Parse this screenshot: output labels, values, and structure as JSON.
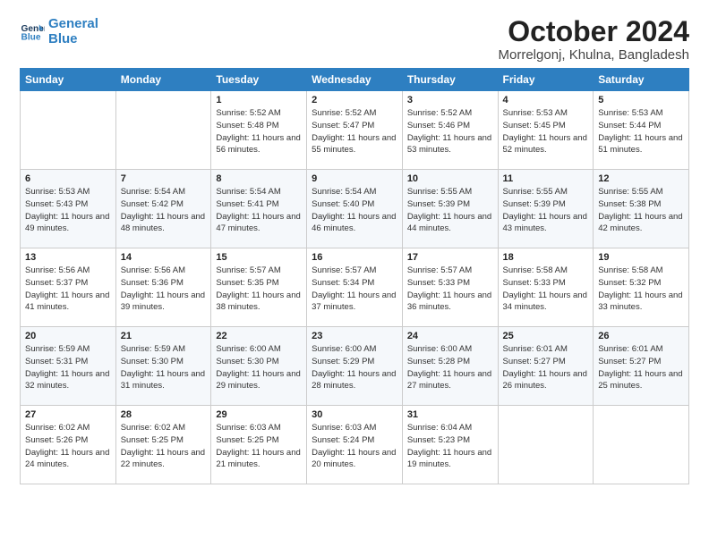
{
  "logo": {
    "line1": "General",
    "line2": "Blue"
  },
  "title": "October 2024",
  "location": "Morrelgonj, Khulna, Bangladesh",
  "weekdays": [
    "Sunday",
    "Monday",
    "Tuesday",
    "Wednesday",
    "Thursday",
    "Friday",
    "Saturday"
  ],
  "weeks": [
    [
      {
        "day": "",
        "detail": ""
      },
      {
        "day": "",
        "detail": ""
      },
      {
        "day": "1",
        "detail": "Sunrise: 5:52 AM\nSunset: 5:48 PM\nDaylight: 11 hours and 56 minutes."
      },
      {
        "day": "2",
        "detail": "Sunrise: 5:52 AM\nSunset: 5:47 PM\nDaylight: 11 hours and 55 minutes."
      },
      {
        "day": "3",
        "detail": "Sunrise: 5:52 AM\nSunset: 5:46 PM\nDaylight: 11 hours and 53 minutes."
      },
      {
        "day": "4",
        "detail": "Sunrise: 5:53 AM\nSunset: 5:45 PM\nDaylight: 11 hours and 52 minutes."
      },
      {
        "day": "5",
        "detail": "Sunrise: 5:53 AM\nSunset: 5:44 PM\nDaylight: 11 hours and 51 minutes."
      }
    ],
    [
      {
        "day": "6",
        "detail": "Sunrise: 5:53 AM\nSunset: 5:43 PM\nDaylight: 11 hours and 49 minutes."
      },
      {
        "day": "7",
        "detail": "Sunrise: 5:54 AM\nSunset: 5:42 PM\nDaylight: 11 hours and 48 minutes."
      },
      {
        "day": "8",
        "detail": "Sunrise: 5:54 AM\nSunset: 5:41 PM\nDaylight: 11 hours and 47 minutes."
      },
      {
        "day": "9",
        "detail": "Sunrise: 5:54 AM\nSunset: 5:40 PM\nDaylight: 11 hours and 46 minutes."
      },
      {
        "day": "10",
        "detail": "Sunrise: 5:55 AM\nSunset: 5:39 PM\nDaylight: 11 hours and 44 minutes."
      },
      {
        "day": "11",
        "detail": "Sunrise: 5:55 AM\nSunset: 5:39 PM\nDaylight: 11 hours and 43 minutes."
      },
      {
        "day": "12",
        "detail": "Sunrise: 5:55 AM\nSunset: 5:38 PM\nDaylight: 11 hours and 42 minutes."
      }
    ],
    [
      {
        "day": "13",
        "detail": "Sunrise: 5:56 AM\nSunset: 5:37 PM\nDaylight: 11 hours and 41 minutes."
      },
      {
        "day": "14",
        "detail": "Sunrise: 5:56 AM\nSunset: 5:36 PM\nDaylight: 11 hours and 39 minutes."
      },
      {
        "day": "15",
        "detail": "Sunrise: 5:57 AM\nSunset: 5:35 PM\nDaylight: 11 hours and 38 minutes."
      },
      {
        "day": "16",
        "detail": "Sunrise: 5:57 AM\nSunset: 5:34 PM\nDaylight: 11 hours and 37 minutes."
      },
      {
        "day": "17",
        "detail": "Sunrise: 5:57 AM\nSunset: 5:33 PM\nDaylight: 11 hours and 36 minutes."
      },
      {
        "day": "18",
        "detail": "Sunrise: 5:58 AM\nSunset: 5:33 PM\nDaylight: 11 hours and 34 minutes."
      },
      {
        "day": "19",
        "detail": "Sunrise: 5:58 AM\nSunset: 5:32 PM\nDaylight: 11 hours and 33 minutes."
      }
    ],
    [
      {
        "day": "20",
        "detail": "Sunrise: 5:59 AM\nSunset: 5:31 PM\nDaylight: 11 hours and 32 minutes."
      },
      {
        "day": "21",
        "detail": "Sunrise: 5:59 AM\nSunset: 5:30 PM\nDaylight: 11 hours and 31 minutes."
      },
      {
        "day": "22",
        "detail": "Sunrise: 6:00 AM\nSunset: 5:30 PM\nDaylight: 11 hours and 29 minutes."
      },
      {
        "day": "23",
        "detail": "Sunrise: 6:00 AM\nSunset: 5:29 PM\nDaylight: 11 hours and 28 minutes."
      },
      {
        "day": "24",
        "detail": "Sunrise: 6:00 AM\nSunset: 5:28 PM\nDaylight: 11 hours and 27 minutes."
      },
      {
        "day": "25",
        "detail": "Sunrise: 6:01 AM\nSunset: 5:27 PM\nDaylight: 11 hours and 26 minutes."
      },
      {
        "day": "26",
        "detail": "Sunrise: 6:01 AM\nSunset: 5:27 PM\nDaylight: 11 hours and 25 minutes."
      }
    ],
    [
      {
        "day": "27",
        "detail": "Sunrise: 6:02 AM\nSunset: 5:26 PM\nDaylight: 11 hours and 24 minutes."
      },
      {
        "day": "28",
        "detail": "Sunrise: 6:02 AM\nSunset: 5:25 PM\nDaylight: 11 hours and 22 minutes."
      },
      {
        "day": "29",
        "detail": "Sunrise: 6:03 AM\nSunset: 5:25 PM\nDaylight: 11 hours and 21 minutes."
      },
      {
        "day": "30",
        "detail": "Sunrise: 6:03 AM\nSunset: 5:24 PM\nDaylight: 11 hours and 20 minutes."
      },
      {
        "day": "31",
        "detail": "Sunrise: 6:04 AM\nSunset: 5:23 PM\nDaylight: 11 hours and 19 minutes."
      },
      {
        "day": "",
        "detail": ""
      },
      {
        "day": "",
        "detail": ""
      }
    ]
  ]
}
